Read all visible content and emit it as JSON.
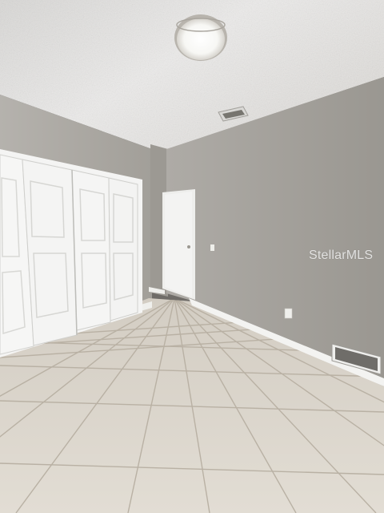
{
  "watermark": {
    "text": "StellarMLS"
  },
  "scene": {
    "description_colors": {
      "ceiling": "#e9e8e6",
      "wall_left": "#a9a6a1",
      "wall_right": "#a3a09b",
      "wall_back": "#99968f",
      "floor_tile": "#dcd6cc",
      "grout": "#b7afa2",
      "door": "#f3f3f2",
      "baseboard": "#f2f2f0"
    }
  }
}
